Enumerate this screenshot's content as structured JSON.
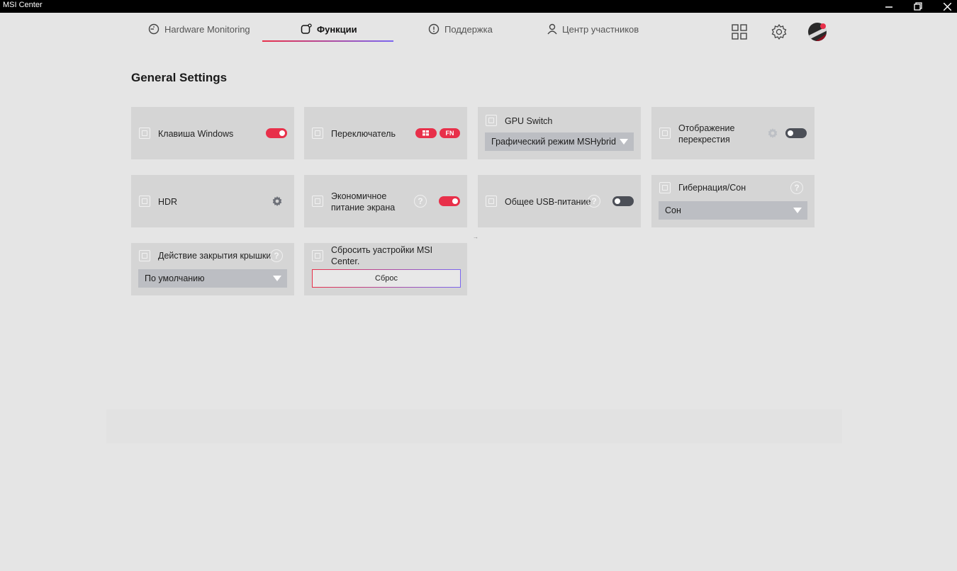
{
  "window": {
    "title": "MSI Center"
  },
  "nav": {
    "tabs": [
      {
        "label": "Hardware Monitoring"
      },
      {
        "label": "Функции"
      },
      {
        "label": "Поддержка"
      },
      {
        "label": "Центр участников"
      }
    ],
    "active": "Функции"
  },
  "section": {
    "title": "General Settings"
  },
  "cards": {
    "windows_key": {
      "label": "Клавиша Windows",
      "toggle": "on"
    },
    "switch": {
      "label": "Переключатель",
      "pill_win": "win-icon",
      "pill_fn": "FN"
    },
    "gpu": {
      "label": "GPU Switch",
      "select": "Графический режим MSHybrid"
    },
    "crosshair": {
      "label_line1": "Отображение",
      "label_line2": "перекрестия",
      "toggle": "off"
    },
    "hdr": {
      "label": "HDR"
    },
    "eco": {
      "label_line1": "Экономичное",
      "label_line2": "питание экрана",
      "help": "?",
      "toggle": "on"
    },
    "usb": {
      "label": "Общее USB-питание",
      "help": "?",
      "toggle": "off"
    },
    "hibernate": {
      "label": "Гибернация/Сон",
      "help": "?",
      "select": "Сон"
    },
    "lid": {
      "label": "Действие закрытия крышки",
      "help": "?",
      "select": "По умолчанию"
    },
    "reset": {
      "label_line1": "Сбросить уастройки MSI",
      "label_line2": "Center.",
      "button": "Сброс"
    }
  },
  "colors": {
    "accent_red": "#e8304a",
    "accent_purple": "#7a66f0",
    "toggle_off": "#4c4f57",
    "card_bg": "#d5d5d5"
  },
  "icons": [
    "minimize-icon",
    "restore-icon",
    "close-icon",
    "gauge-icon",
    "functions-icon",
    "support-chat-icon",
    "user-icon",
    "grid-icon",
    "settings-gear-icon",
    "avatar"
  ]
}
